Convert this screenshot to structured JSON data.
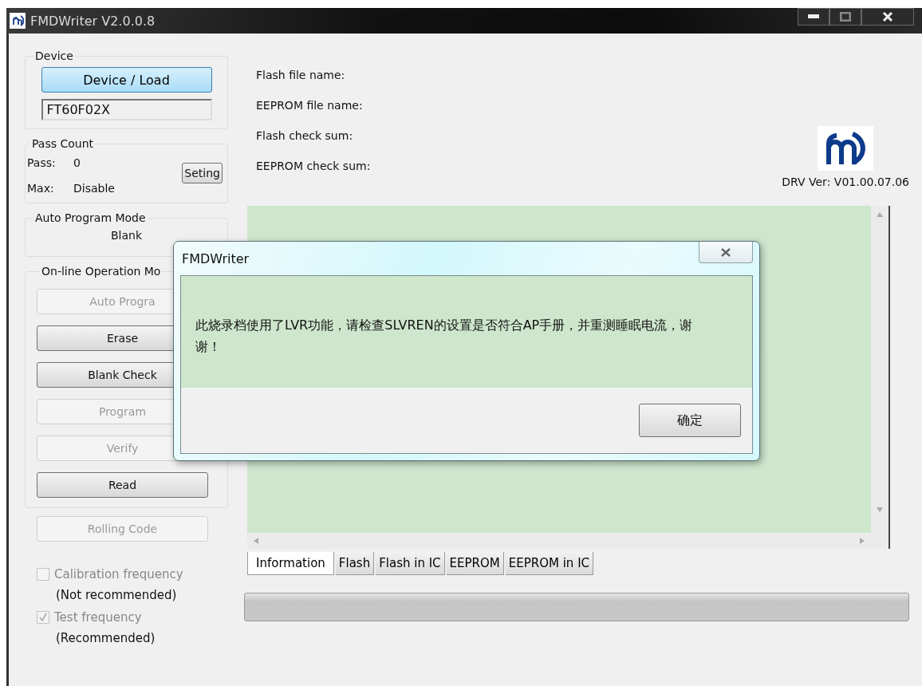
{
  "window": {
    "title": "FMDWriter V2.0.0.8"
  },
  "device": {
    "title": "Device",
    "load_button": "Device / Load",
    "value": "FT60F02X"
  },
  "pass_count": {
    "title": "Pass Count",
    "pass_label": "Pass:",
    "pass_value": "0",
    "max_label": "Max:",
    "max_value": "Disable",
    "setting_button": "Seting"
  },
  "auto_program_mode": {
    "title": "Auto Program Mode",
    "value": "Blank"
  },
  "online_operation": {
    "title": "On-line Operation Mo",
    "buttons": [
      {
        "label": "Auto Progra",
        "disabled": true
      },
      {
        "label": "Erase",
        "disabled": false
      },
      {
        "label": "Blank Check",
        "disabled": false
      },
      {
        "label": "Program",
        "disabled": true
      },
      {
        "label": "Verify",
        "disabled": true
      },
      {
        "label": "Read",
        "disabled": false
      }
    ]
  },
  "rolling_code_button": {
    "label": "Rolling Code",
    "disabled": true
  },
  "options": [
    {
      "label": "Calibration frequency",
      "note": "(Not recommended)",
      "checked": false,
      "disabled": true
    },
    {
      "label": "Test frequency",
      "note": "(Recommended)",
      "checked": true,
      "disabled": true
    }
  ],
  "file_info": [
    "Flash file name:",
    "EEPROM file name:",
    "Flash check sum:",
    "EEPROM check sum:"
  ],
  "driver_version": "DRV Ver: V01.00.07.06",
  "tabs": [
    {
      "label": "Information",
      "selected": true
    },
    {
      "label": "Flash",
      "selected": false
    },
    {
      "label": "Flash in IC",
      "selected": false
    },
    {
      "label": "EEPROM",
      "selected": false
    },
    {
      "label": "EEPROM in IC",
      "selected": false
    }
  ],
  "progress": {
    "level": 0
  },
  "dialog": {
    "title": "FMDWriter",
    "message": "此烧录档使用了LVR功能，请检查SLVREN的设置是否符合AP手册，并重测睡眠电流，谢谢！",
    "ok_button": "确定"
  }
}
